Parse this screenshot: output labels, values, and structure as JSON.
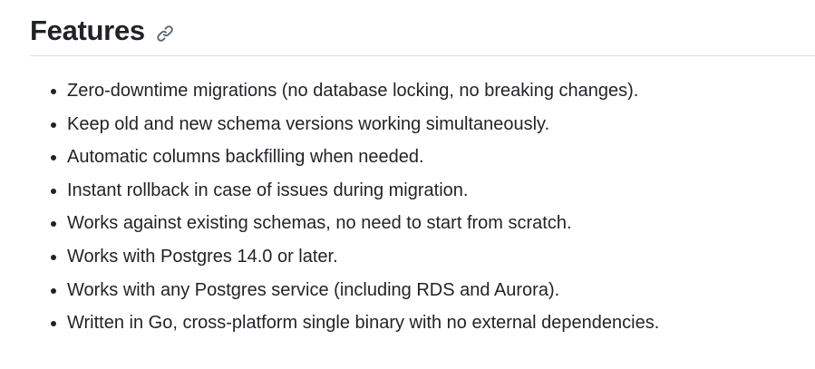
{
  "heading": {
    "title": "Features",
    "anchor_icon": "link-icon"
  },
  "features": [
    "Zero-downtime migrations (no database locking, no breaking changes).",
    "Keep old and new schema versions working simultaneously.",
    "Automatic columns backfilling when needed.",
    "Instant rollback in case of issues during migration.",
    "Works against existing schemas, no need to start from scratch.",
    "Works with Postgres 14.0 or later.",
    "Works with any Postgres service (including RDS and Aurora).",
    "Written in Go, cross-platform single binary with no external dependencies."
  ]
}
